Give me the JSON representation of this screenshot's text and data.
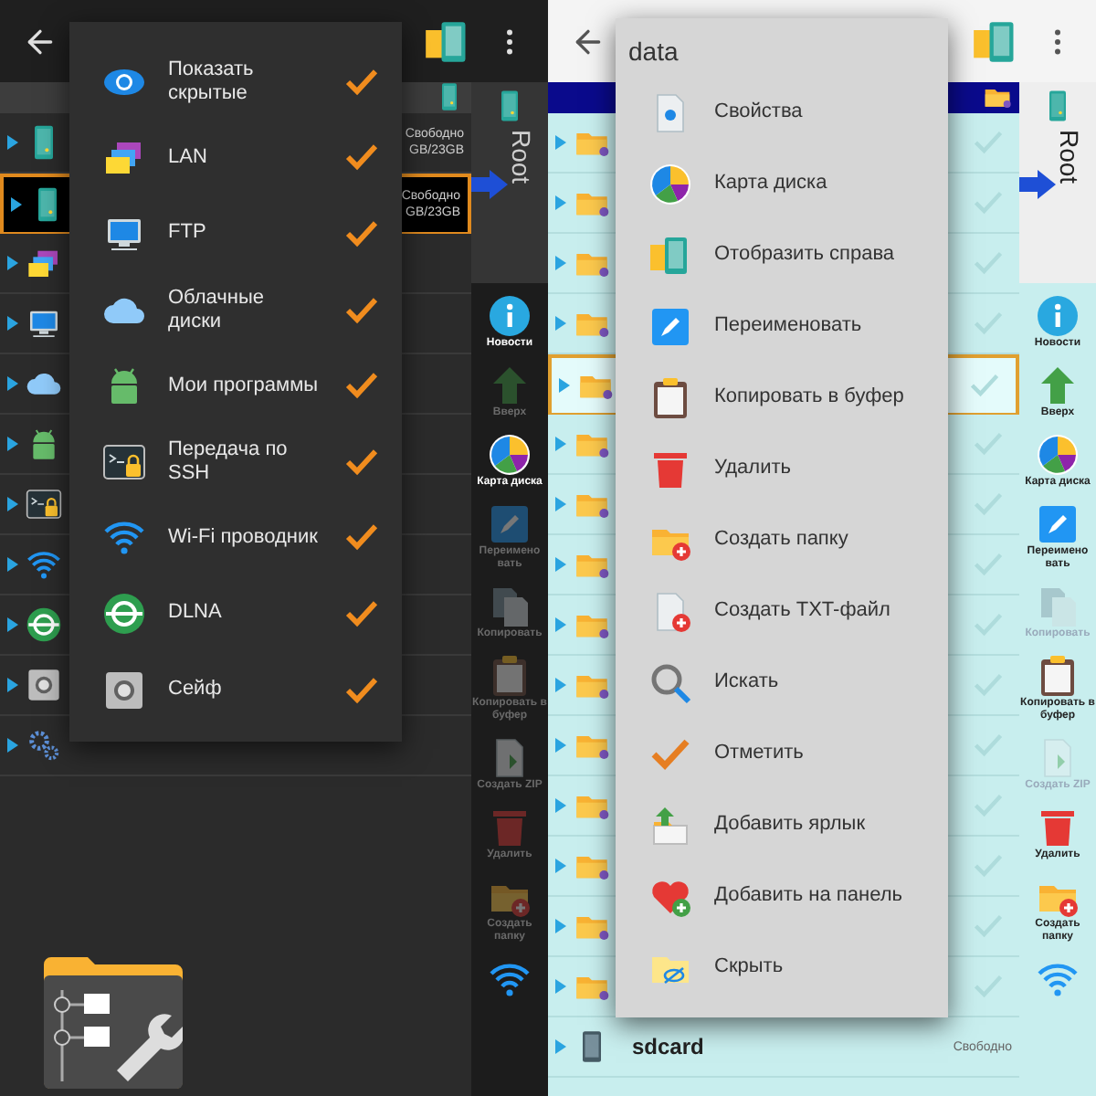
{
  "screens": [
    {
      "dark": true,
      "side_label": "Root",
      "rows": [
        {
          "kind": "phone",
          "selected": false,
          "free": "Свободно",
          "size": "GB/23GB"
        },
        {
          "kind": "phone",
          "selected": true,
          "free": "Свободно",
          "size": "GB/23GB"
        },
        {
          "kind": "lan",
          "selected": false
        },
        {
          "kind": "ftp",
          "selected": false
        },
        {
          "kind": "cloud",
          "selected": false
        },
        {
          "kind": "android",
          "selected": false
        },
        {
          "kind": "ssh",
          "selected": false
        },
        {
          "kind": "wifi",
          "selected": false
        },
        {
          "kind": "dlna",
          "selected": false
        },
        {
          "kind": "safe",
          "selected": false
        },
        {
          "kind": "settings",
          "selected": false
        }
      ],
      "toolbar": [
        {
          "kind": "news",
          "label": "Новости",
          "disabled": false
        },
        {
          "kind": "up",
          "label": "Вверх",
          "disabled": true
        },
        {
          "kind": "diskmap",
          "label": "Карта диска",
          "disabled": false
        },
        {
          "kind": "rename",
          "label": "Переимено вать",
          "disabled": true
        },
        {
          "kind": "copy",
          "label": "Копировать",
          "disabled": true
        },
        {
          "kind": "clipboard",
          "label": "Копировать в буфер",
          "disabled": true
        },
        {
          "kind": "zip",
          "label": "Создать ZIP",
          "disabled": true
        },
        {
          "kind": "delete",
          "label": "Удалить",
          "disabled": true
        },
        {
          "kind": "newfolder",
          "label": "Создать папку",
          "disabled": true
        },
        {
          "kind": "wifi",
          "disabled": false
        }
      ],
      "menu": {
        "items": [
          {
            "kind": "eye",
            "label": "Показать скрытые",
            "checked": true
          },
          {
            "kind": "lan",
            "label": "LAN",
            "checked": true
          },
          {
            "kind": "ftp",
            "label": "FTP",
            "checked": true
          },
          {
            "kind": "cloud",
            "label": "Облачные диски",
            "checked": true
          },
          {
            "kind": "android",
            "label": "Мои программы",
            "checked": true
          },
          {
            "kind": "ssh",
            "label": "Передача по SSH",
            "checked": true
          },
          {
            "kind": "wifi",
            "label": "Wi-Fi проводник",
            "checked": true
          },
          {
            "kind": "dlna",
            "label": "DLNA",
            "checked": true
          },
          {
            "kind": "safe",
            "label": "Сейф",
            "checked": true
          }
        ]
      }
    },
    {
      "dark": false,
      "side_label": "Root",
      "rows": [
        {
          "kind": "folder",
          "selected": false
        },
        {
          "kind": "folder",
          "selected": false
        },
        {
          "kind": "folder",
          "selected": false
        },
        {
          "kind": "folder",
          "selected": false
        },
        {
          "kind": "folder",
          "selected": true
        },
        {
          "kind": "folder",
          "selected": false
        },
        {
          "kind": "folder",
          "selected": false
        },
        {
          "kind": "folder",
          "selected": false
        },
        {
          "kind": "folder",
          "selected": false
        },
        {
          "kind": "folder",
          "selected": false
        },
        {
          "kind": "folder",
          "selected": false
        },
        {
          "kind": "folder",
          "selected": false
        },
        {
          "kind": "folder",
          "selected": false
        },
        {
          "kind": "folder",
          "selected": false
        },
        {
          "kind": "folder",
          "selected": false
        },
        {
          "kind": "sdcard",
          "selected": false,
          "name": "sdcard",
          "free": "Свободно"
        }
      ],
      "toolbar": [
        {
          "kind": "news",
          "label": "Новости",
          "disabled": false
        },
        {
          "kind": "up",
          "label": "Вверх",
          "disabled": false
        },
        {
          "kind": "diskmap",
          "label": "Карта диска",
          "disabled": false
        },
        {
          "kind": "rename",
          "label": "Переимено вать",
          "disabled": false
        },
        {
          "kind": "copy",
          "label": "Копировать",
          "disabled": true
        },
        {
          "kind": "clipboard",
          "label": "Копировать в буфер",
          "disabled": false
        },
        {
          "kind": "zip",
          "label": "Создать ZIP",
          "disabled": true
        },
        {
          "kind": "delete",
          "label": "Удалить",
          "disabled": false
        },
        {
          "kind": "newfolder",
          "label": "Создать папку",
          "disabled": false
        },
        {
          "kind": "wifi",
          "disabled": false
        }
      ],
      "menu": {
        "title": "data",
        "items": [
          {
            "kind": "props",
            "label": "Свойства"
          },
          {
            "kind": "diskmap",
            "label": "Карта диска"
          },
          {
            "kind": "showright",
            "label": "Отобразить справа"
          },
          {
            "kind": "rename",
            "label": "Переименовать"
          },
          {
            "kind": "clipboard",
            "label": "Копировать в буфер"
          },
          {
            "kind": "delete",
            "label": "Удалить"
          },
          {
            "kind": "newfolder",
            "label": "Создать папку"
          },
          {
            "kind": "newtxt",
            "label": "Создать TXT-файл"
          },
          {
            "kind": "search",
            "label": "Искать"
          },
          {
            "kind": "check",
            "label": "Отметить"
          },
          {
            "kind": "shortcut",
            "label": "Добавить ярлык"
          },
          {
            "kind": "favorite",
            "label": "Добавить на панель"
          },
          {
            "kind": "hide",
            "label": "Скрыть"
          }
        ]
      }
    }
  ]
}
